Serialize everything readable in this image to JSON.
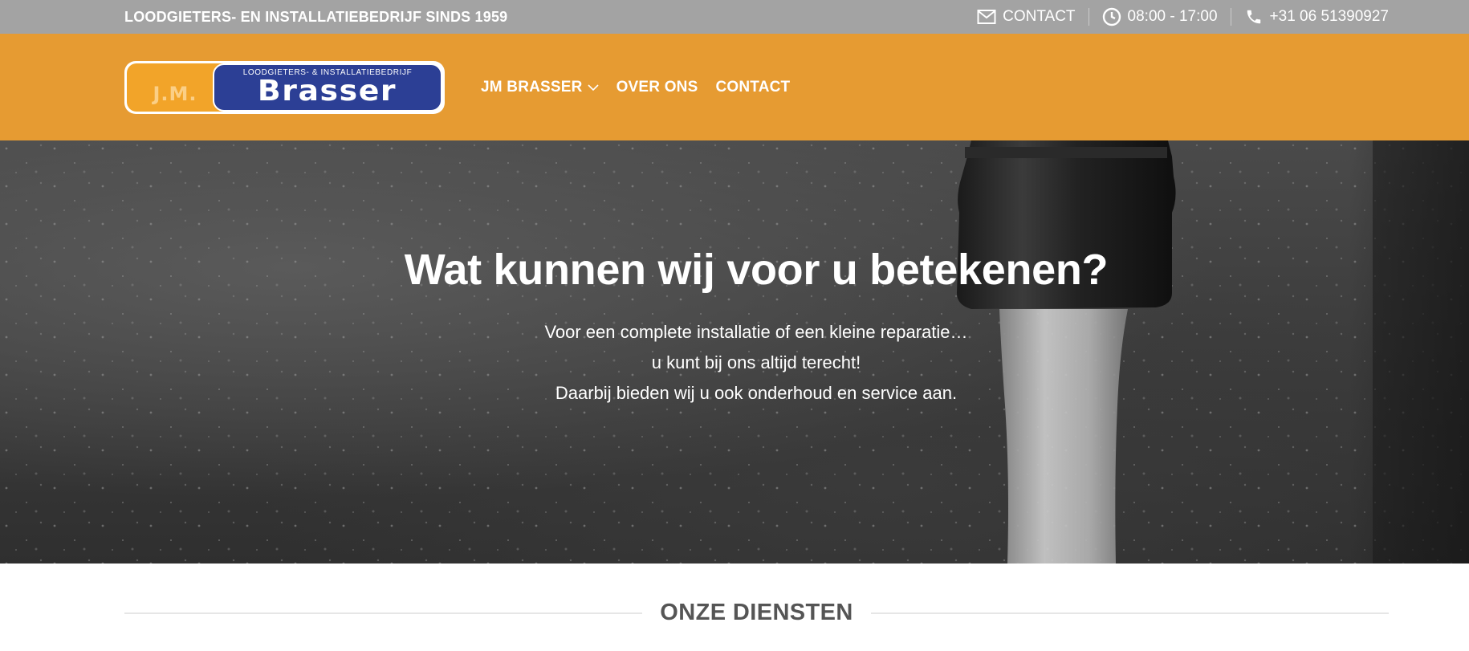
{
  "topbar": {
    "tagline": "LOODGIETERS- EN INSTALLATIEBEDRIJF SINDS 1959",
    "contact_label": "CONTACT",
    "hours": "08:00 - 17:00",
    "phone": "+31 06 51390927"
  },
  "logo": {
    "initials": "J.M.",
    "subtitle": "LOODGIETERS- & INSTALLATIEBEDRIJF",
    "name": "Brasser"
  },
  "nav": {
    "items": [
      {
        "label": "JM BRASSER"
      },
      {
        "label": "OVER ONS"
      },
      {
        "label": "CONTACT"
      }
    ]
  },
  "hero": {
    "title": "Wat kunnen wij voor u betekenen?",
    "lines": [
      "Voor een complete installatie of een kleine reparatie…",
      "u kunt bij ons altijd terecht!",
      "Daarbij bieden wij u ook onderhoud en service aan."
    ]
  },
  "section": {
    "title": "ONZE DIENSTEN"
  },
  "colors": {
    "topbar": "#a3a3a3",
    "header": "#e69b32",
    "logo_blue": "#2c3f95",
    "logo_orange": "#f2a429"
  },
  "icons": [
    "envelope-icon",
    "clock-icon",
    "phone-icon",
    "chevron-down-icon"
  ]
}
